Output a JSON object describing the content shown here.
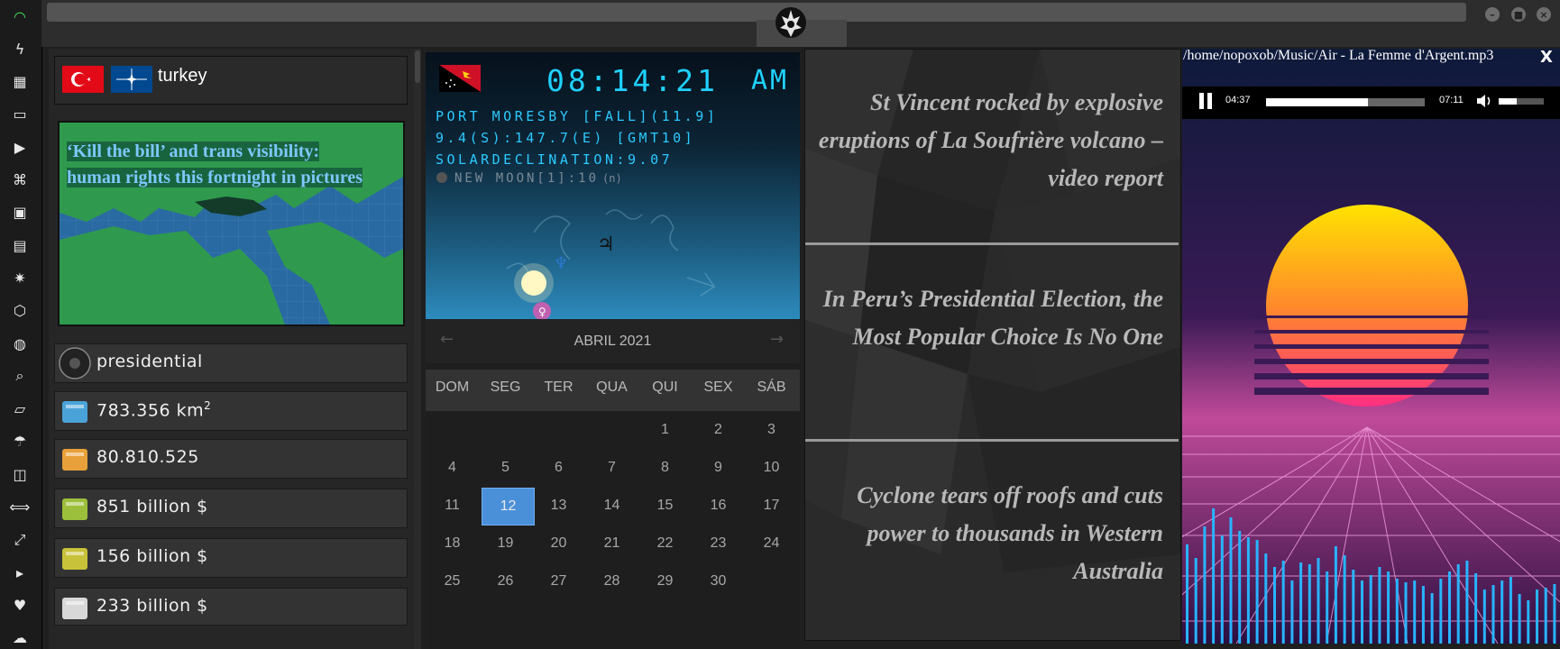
{
  "sidebar": {
    "icons": [
      "wifi-icon",
      "lightning-icon",
      "windows-icon",
      "archive-icon",
      "play-icon",
      "translate-icon",
      "image-icon",
      "news-icon",
      "empire-icon",
      "hexagon-icon",
      "globe-icon",
      "search-icon",
      "map-icon",
      "umbrella-icon",
      "contact-icon",
      "handshake-icon",
      "expand-icon",
      "youtube-icon",
      "heart-icon",
      "cloud-icon"
    ]
  },
  "country": {
    "name": "turkey",
    "news_caption": "‘Kill the bill’ and trans visibility: human rights this fortnight in pictures",
    "stats": [
      {
        "icon": "empire-seal-icon",
        "value": "presidential"
      },
      {
        "icon": "map-pin-icon",
        "value": "783.356 km",
        "sup": "2"
      },
      {
        "icon": "population-icon",
        "value": "80.810.525"
      },
      {
        "icon": "money-pallet-icon",
        "value": "851 billion $"
      },
      {
        "icon": "forklift-icon",
        "value": "156 billion $"
      },
      {
        "icon": "boxes-icon",
        "value": "233 billion $"
      }
    ]
  },
  "clock": {
    "time": "08:14:21",
    "ampm": "AM",
    "city": "PORT MORESBY [FALL](11.9]",
    "coords": "9.4(S):147.7(E) [GMT10]",
    "declination": "SOLARDECLINATION:9.07",
    "moon": "NEW MOON[1]:10",
    "moon_suffix": "(n)"
  },
  "calendar": {
    "title": "ABRIL 2021",
    "weekdays": [
      "DOM",
      "SEG",
      "TER",
      "QUA",
      "QUI",
      "SEX",
      "SÁB"
    ],
    "weeks": [
      [
        "",
        "",
        "",
        "",
        "1",
        "2",
        "3"
      ],
      [
        "4",
        "5",
        "6",
        "7",
        "8",
        "9",
        "10"
      ],
      [
        "11",
        "12",
        "13",
        "14",
        "15",
        "16",
        "17"
      ],
      [
        "18",
        "19",
        "20",
        "21",
        "22",
        "23",
        "24"
      ],
      [
        "25",
        "26",
        "27",
        "28",
        "29",
        "30",
        ""
      ]
    ],
    "today": "12"
  },
  "news": {
    "headlines": [
      "St Vincent rocked by explosive eruptions of La Soufrière volcano – video report",
      "In Peru’s Presidential Election, the Most Popular Choice Is No One",
      "Cyclone tears off roofs and cuts power to thousands in Western Australia"
    ]
  },
  "player": {
    "path": "/home/nopoxob/Music/Air - La Femme d'Argent.mp3",
    "elapsed": "04:37",
    "duration": "07:11",
    "progress": 0.64,
    "volume": 0.4,
    "close_label": "X"
  }
}
